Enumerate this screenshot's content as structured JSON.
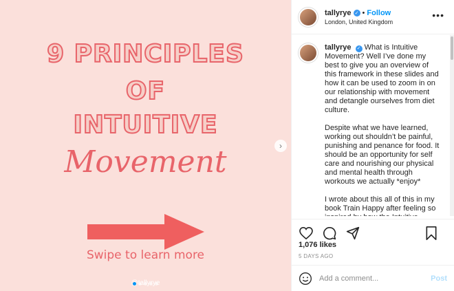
{
  "slide": {
    "line1": "9 PRINCIPLES",
    "line2": "OF",
    "line3": "INTUITIVE",
    "script_word": "Movement",
    "swipe_text": "Swipe to learn more",
    "handle": "@tallyrye"
  },
  "header": {
    "username": "tallyrye",
    "separator": "•",
    "follow_label": "Follow",
    "location": "London, United Kingdom",
    "more_icon": "more-horizontal-icon"
  },
  "caption": {
    "username": "tallyrye",
    "paragraphs": [
      "What is Intuitive Movement? Well I’ve done my best to give you an overview of this framework in these slides and how it can be used to zoom in on our relationship with movement and detangle ourselves from diet culture.",
      "Despite what we have learned, working out shouldn’t be painful, punishing and penance for food. It should be an opportunity for self care and nourishing our physical and mental health through workouts we actually *enjoy*",
      "I wrote about this all of this in my book Train Happy after feeling so inspired by how the Intuitive Eating"
    ]
  },
  "actions": {
    "like_icon": "heart-icon",
    "comment_icon": "comment-icon",
    "share_icon": "share-icon",
    "save_icon": "bookmark-icon"
  },
  "likes": "1,076 likes",
  "date": "5 DAYS AGO",
  "comment": {
    "placeholder": "Add a comment...",
    "post_label": "Post",
    "emoji_icon": "smiley-icon"
  },
  "colors": {
    "slide_bg": "#fbe0db",
    "accent": "#e8646a",
    "link_blue": "#0095f6"
  }
}
